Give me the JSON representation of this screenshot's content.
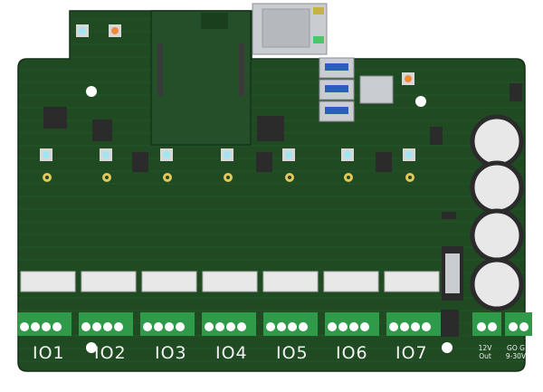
{
  "board": {
    "colors": {
      "soldermask": "#1f4a22",
      "soldermask_dark": "#173a1a",
      "silkscreen": "#f2f2f2",
      "terminal_green": "#2f9a4a",
      "led_blue": "#9fe6f2",
      "led_orange": "#f08a3a",
      "pad_gold": "#e2c85a",
      "ethernet_metal": "#c9ccd1",
      "usb_blue": "#2a5fbf",
      "capacitor_top": "#e8e8e8"
    },
    "io_channels": [
      {
        "label": "IO1"
      },
      {
        "label": "IO2"
      },
      {
        "label": "IO3"
      },
      {
        "label": "IO4"
      },
      {
        "label": "IO5"
      },
      {
        "label": "IO6"
      },
      {
        "label": "IO7"
      }
    ],
    "power_out": {
      "line1": "12V",
      "line2": "Out"
    },
    "power_in": {
      "line1": "GO G",
      "line2": "9-30V"
    },
    "components": {
      "ethernet": "ethernet-jack-icon",
      "usb": "usb-port-icon",
      "sd": "sd-card-slot-icon",
      "capacitor": "electrolytic-capacitor-icon",
      "terminal": "screw-terminal-icon"
    }
  }
}
